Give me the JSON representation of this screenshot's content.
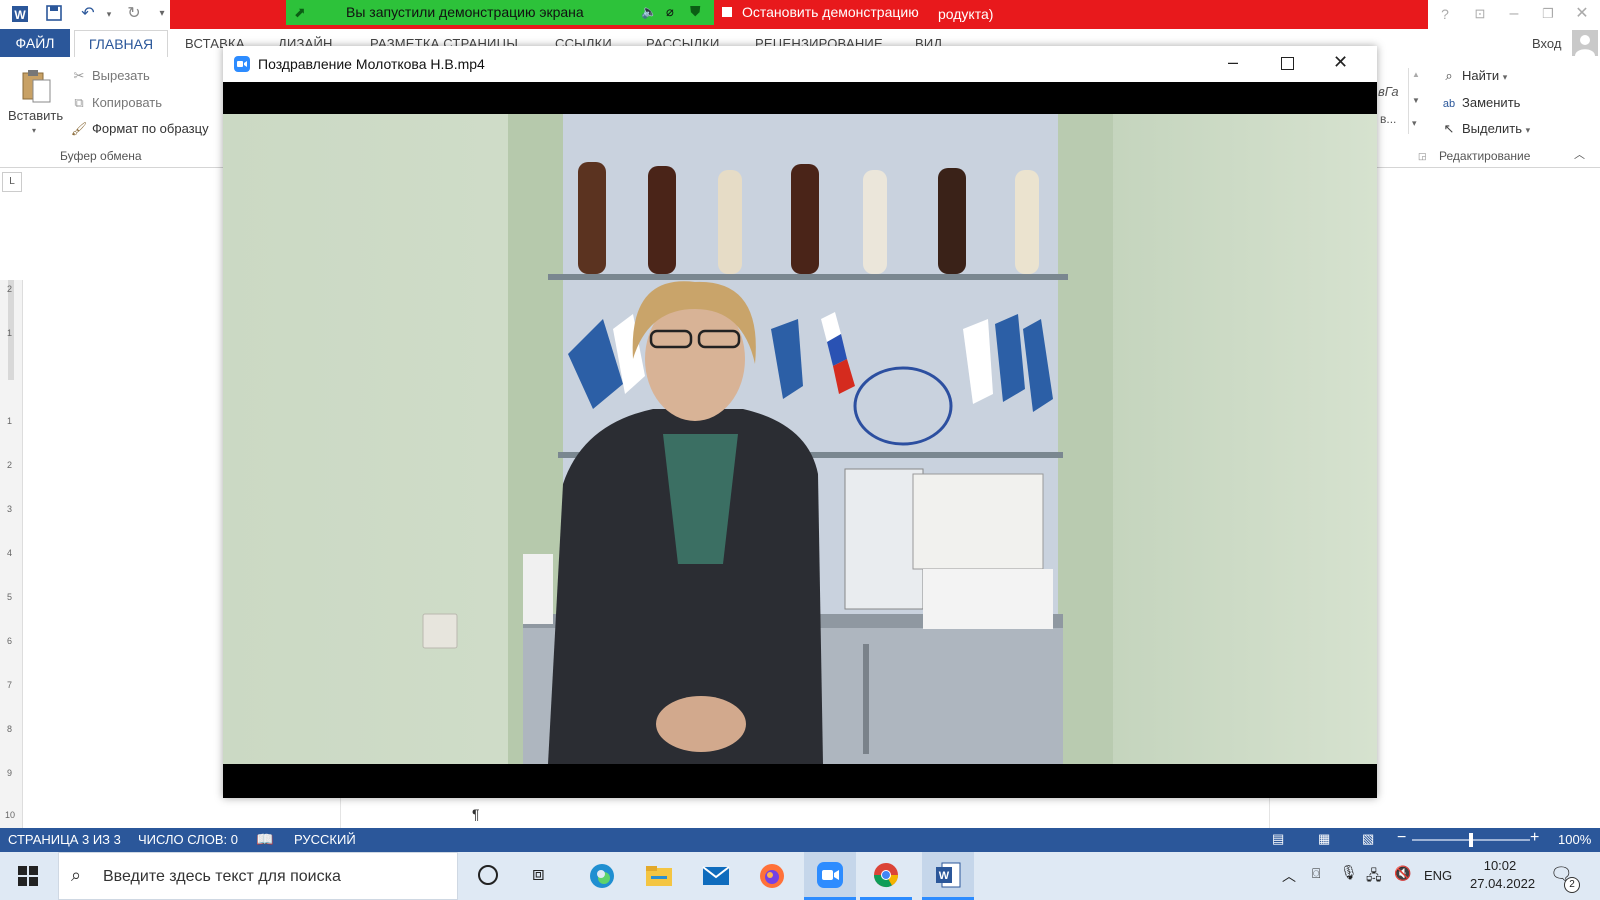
{
  "zoom_bar": {
    "share_message": "Вы запустили демонстрацию экрана",
    "stop_button": "Остановить демонстрацию",
    "behind_text": "родукта)"
  },
  "word": {
    "signin": "Вход",
    "tabs": [
      "ФАЙЛ",
      "ГЛАВНАЯ",
      "ВСТАВКА",
      "ДИЗАЙН",
      "РАЗМЕТКА СТРАНИЦЫ",
      "ССЫЛКИ",
      "РАССЫЛКИ",
      "РЕЦЕНЗИРОВАНИЕ",
      "ВИД"
    ],
    "clipboard": {
      "paste": "Вставить",
      "cut": "Вырезать",
      "copy": "Копировать",
      "format_painter": "Формат по образцу",
      "group_label": "Буфер обмена"
    },
    "styles_fragment": [
      "вГа",
      "в..."
    ],
    "editing": {
      "find": "Найти",
      "replace": "Заменить",
      "select": "Выделить",
      "group_label": "Редактирование"
    },
    "pilcrow": "¶",
    "ruler_numbers": [
      "2",
      "1",
      "1",
      "2",
      "3",
      "4",
      "5",
      "6",
      "7",
      "8",
      "9",
      "10"
    ],
    "status": {
      "page": "СТРАНИЦА 3 ИЗ 3",
      "words": "ЧИСЛО СЛОВ: 0",
      "language": "РУССКИЙ",
      "zoom": "100%",
      "zoom_level": 0.5
    }
  },
  "video_window": {
    "title": "Поздравление Молоткова Н.В.mp4"
  },
  "taskbar": {
    "search_placeholder": "Введите здесь текст для поиска",
    "lang": "ENG",
    "time": "10:02",
    "date": "27.04.2022",
    "notifications": "2"
  },
  "colors": {
    "word_blue": "#2b579a",
    "zoom_green": "#2dc23a",
    "zoom_red": "#e8191c",
    "zoom_blue": "#2d8cff"
  }
}
